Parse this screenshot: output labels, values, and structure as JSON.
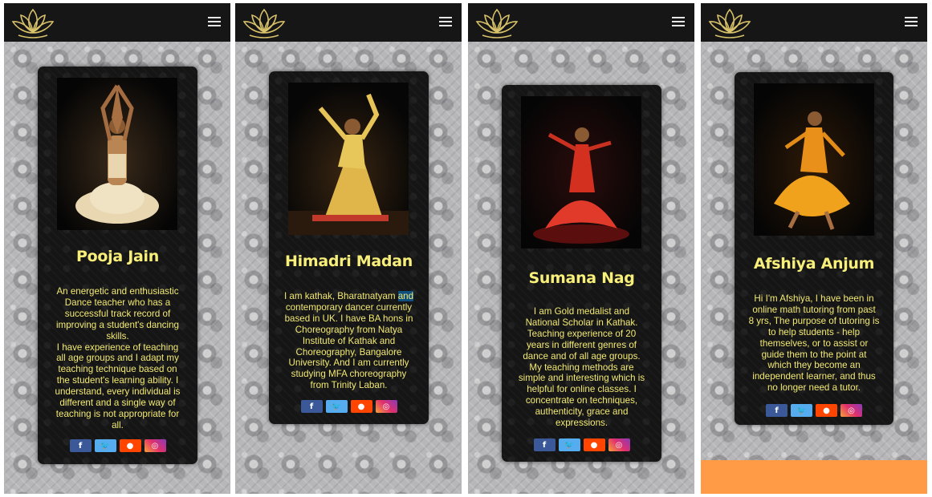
{
  "nav": {
    "logo_icon": "lotus-logo-icon",
    "menu_icon": "hamburger-menu-icon"
  },
  "colors": {
    "name_yellow": "#f8ef7a",
    "text_yellow": "#f3ea73",
    "topbar": "#161616",
    "card": "#151515",
    "footer_orange": "#ff9a46"
  },
  "social": {
    "facebook": {
      "icon": "facebook-icon",
      "glyph": "f",
      "color": "#3b5998"
    },
    "twitter": {
      "icon": "twitter-icon",
      "glyph": "🐦",
      "color": "#55acee"
    },
    "reddit": {
      "icon": "reddit-icon",
      "glyph": "●",
      "color": "#ff4500"
    },
    "instagram": {
      "icon": "instagram-icon",
      "glyph": "◎",
      "color": "#e1306c"
    }
  },
  "teachers": [
    {
      "name": "Pooja Jain",
      "bio": "An energetic and enthusiastic\nDance teacher who has a\nsuccessful track record of\nimproving a student's dancing\nskills.\nI have experience of teaching\nall age groups and I adapt my\nteaching technique based on\nthe student's learning ability. I\nunderstand, every individual is\ndifferent and a single way of\nteaching is not appropriate for\nall."
    },
    {
      "name": "Himadri Madan",
      "bio_pre": "I am kathak, Bharatnatyam ",
      "bio_highlight": "and",
      "bio_post": "\ncontemporary dancer currently\nbased in UK. I have BA hons in\nChoreography from Natya\nInstitute of Kathak and\nChoreography, Bangalore\nUniversity. And I am currently\nstudying MFA choreography\nfrom Trinity Laban."
    },
    {
      "name": "Sumana Nag",
      "bio": "I am Gold medalist and\nNational Scholar in Kathak.\nTeaching experience of 20\nyears in different genres of\ndance and of all age groups.\nMy teaching methods are\nsimple and interesting which is\nhelpful for online classes. I\nconcentrate on techniques,\nauthenticity, grace and\nexpressions."
    },
    {
      "name": "Afshiya Anjum",
      "bio": "Hi I'm Afshiya, I have been in\nonline math tutoring from past\n8 yrs, The purpose of tutoring is\nto help students - help\nthemselves, or to assist or\nguide them to the point at\nwhich they become an\nindependent learner, and thus\nno longer need a tutor."
    }
  ]
}
